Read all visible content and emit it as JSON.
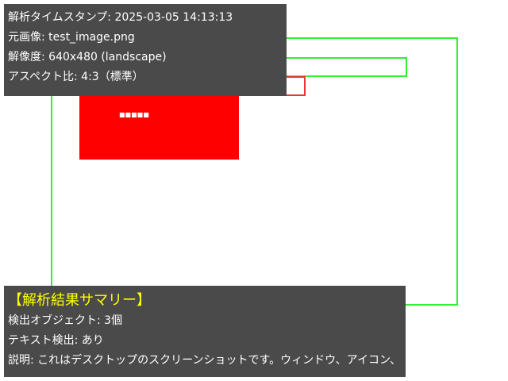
{
  "info_panel": {
    "timestamp": "解析タイムスタンプ: 2025-03-05 14:13:13",
    "source_image": "元画像: test_image.png",
    "resolution": "解像度: 640x480 (landscape)",
    "aspect_ratio": "アスペクト比: 4:3（標準）"
  },
  "detections": {
    "red_box_label": "■■■■■"
  },
  "summary_panel": {
    "title": "【解析結果サマリー】",
    "object_count": "検出オブジェクト: 3個",
    "text_detected": "テキスト検出: あり",
    "description": "説明: これはデスクトップのスクリーンショットです。ウィンドウ、アイコン、"
  },
  "colors": {
    "detection_green": "#33ee33",
    "detection_red": "#ee3333",
    "fill_red": "#ff0000",
    "panel_bg": "#4a4a4a",
    "title_yellow": "#ffff00"
  }
}
